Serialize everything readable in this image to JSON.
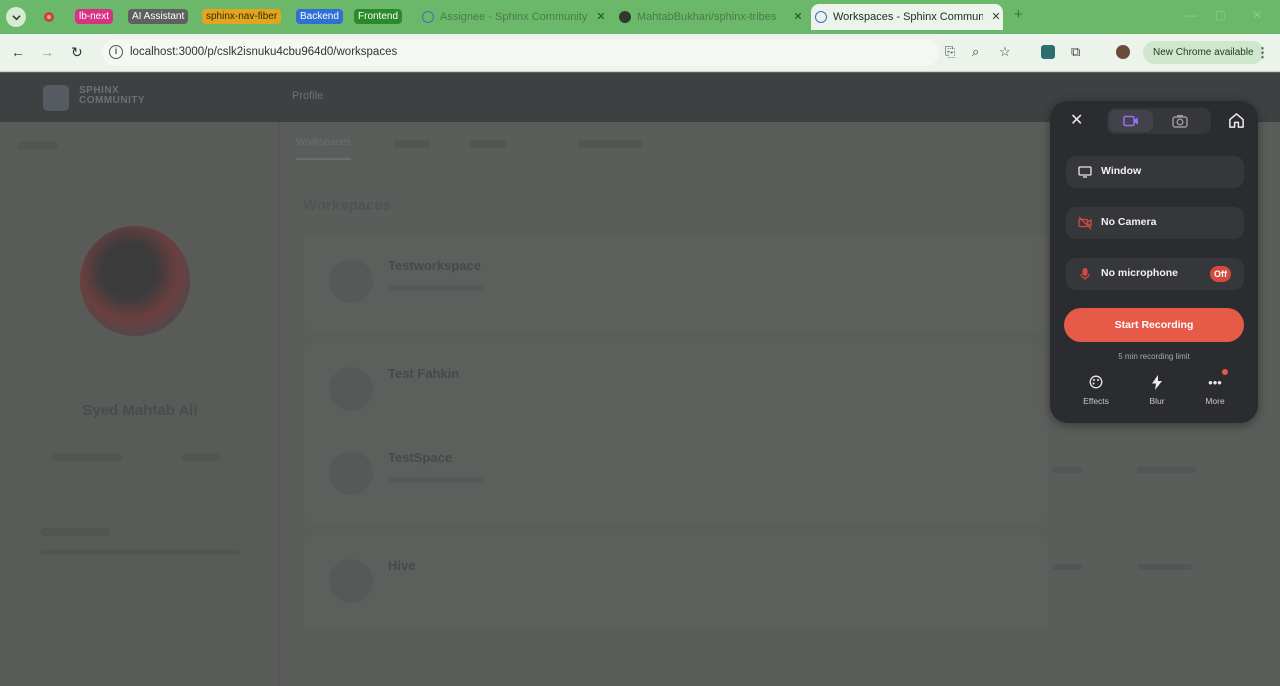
{
  "browser": {
    "tab_groups": [
      {
        "label": "lb-next",
        "color": "#d63384"
      },
      {
        "label": "AI Assistant",
        "color": "#6c6c6c"
      },
      {
        "label": "sphinx-nav-fiber",
        "color": "#e0a020"
      },
      {
        "label": "Backend",
        "color": "#2f6fd6"
      },
      {
        "label": "Frontend",
        "color": "#2a8a2a"
      }
    ],
    "tabs": [
      {
        "title": "Assignee - Sphinx Community",
        "active": false
      },
      {
        "title": "MahtabBukhari/sphinx-tribes",
        "active": false
      },
      {
        "title": "Workspaces - Sphinx Commun...",
        "active": true
      }
    ],
    "url": "localhost:3000/p/cslk2isnuku4cbu964d0/workspaces",
    "update_pill": "New Chrome available"
  },
  "app": {
    "logo_text_1": "SPHINX",
    "logo_text_2": "COMMUNITY",
    "nav": [
      "",
      "Profile",
      "",
      ""
    ],
    "user_name": "Syed Mahtab Ali",
    "subtabs": [
      "Workspaces",
      "",
      "",
      ""
    ],
    "heading": "Workspaces",
    "workspaces": [
      {
        "name": "Testworkspace"
      },
      {
        "name": "Test Fahkin"
      },
      {
        "name": "TestSpace"
      },
      {
        "name": "Hive"
      }
    ]
  },
  "recorder": {
    "colors": {
      "accent": "#e65a47",
      "panel": "#2b2c2f",
      "video_mode": "#8b5cf6"
    },
    "options": [
      {
        "label": "Window",
        "icon": "monitor-icon"
      },
      {
        "label": "No Camera",
        "icon": "camera-off-icon"
      },
      {
        "label": "No microphone",
        "icon": "mic-off-icon",
        "badge": "Off"
      }
    ],
    "start_label": "Start Recording",
    "limit_text": "5 min recording limit",
    "footer": [
      {
        "label": "Effects",
        "icon": "palette-icon"
      },
      {
        "label": "Blur",
        "icon": "bolt-icon"
      },
      {
        "label": "More",
        "icon": "more-icon"
      }
    ]
  }
}
